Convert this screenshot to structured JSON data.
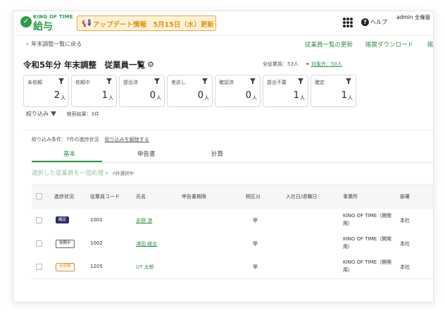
{
  "header": {
    "logo_sub": "KING OF TIME",
    "logo_main": "給与",
    "update_banner": "アップデート情報　5月15日（水）更新",
    "help_label": "ヘルプ",
    "user_label": "admin 全権管"
  },
  "nav": {
    "back_label": "年末調整一覧に戻る",
    "links": [
      "従業員一覧の更新",
      "帳票ダウンロード",
      "帳"
    ]
  },
  "page": {
    "title": "令和5年分 年末調整　従業員一覧",
    "total_count": "全従業員：53人",
    "excluded_count": "対象外：50人"
  },
  "status_cards": [
    {
      "label": "未依頼",
      "count": "2",
      "unit": "人"
    },
    {
      "label": "依頼中",
      "count": "1",
      "unit": "人"
    },
    {
      "label": "提出済",
      "count": "0",
      "unit": "人"
    },
    {
      "label": "差戻し",
      "count": "0",
      "unit": "人"
    },
    {
      "label": "確認済",
      "count": "0",
      "unit": "人"
    },
    {
      "label": "提出不要",
      "count": "1",
      "unit": "人"
    },
    {
      "label": "確定",
      "count": "1",
      "unit": "人"
    }
  ],
  "filter": {
    "label": "絞り込み",
    "result": "検索結果：3件"
  },
  "panel": {
    "condition": "絞り込み条件：7件の進捗状況",
    "condition_clear": "絞り込みを解除する",
    "tabs": [
      "基本",
      "申告書",
      "計算"
    ],
    "bulk_action": "選択した従業員を一括処理",
    "selected_count": "0件選択中"
  },
  "table": {
    "columns": [
      "進捗状況",
      "従業員コード",
      "氏名",
      "申告書期限",
      "税区分",
      "入社日/退職日",
      "事業所",
      "部署"
    ],
    "rows": [
      {
        "status": "確定",
        "status_type": "kanryo",
        "code": "1001",
        "name": "永野 涼",
        "deadline": "",
        "tax": "甲",
        "date": "",
        "office": "KING OF TIME（開発\n用）",
        "dept": "本社"
      },
      {
        "status": "依頼中",
        "status_type": "irai",
        "code": "1002",
        "name": "津田 綾女",
        "deadline": "",
        "tax": "甲",
        "date": "",
        "office": "KING OF TIME（開発\n用）",
        "dept": "本社"
      },
      {
        "status": "未依頼",
        "status_type": "mi",
        "code": "1205",
        "name": "UT 太郎",
        "deadline": "",
        "tax": "甲",
        "date": "",
        "office": "KING OF TIME（開発\n用）",
        "dept": "本社"
      }
    ]
  },
  "colors": {
    "brand_green": "#2e9a4a",
    "banner_orange": "#e69118",
    "badge_navy": "#2d2f66"
  }
}
